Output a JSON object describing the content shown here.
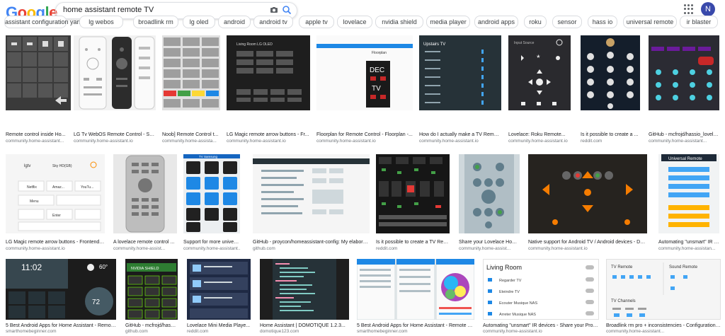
{
  "search": {
    "query": "home assistant remote TV"
  },
  "logo": {
    "letters": [
      "G",
      "o",
      "o",
      "g",
      "l",
      "e"
    ]
  },
  "avatar": {
    "initial": "N"
  },
  "chips": [
    "assistant configuration yaml",
    "lg webos",
    "broadlink rm",
    "lg oled",
    "android",
    "android tv",
    "apple tv",
    "lovelace",
    "nvidia shield",
    "media player",
    "android apps",
    "roku",
    "sensor",
    "hass io",
    "universal remote",
    "ir blaster"
  ],
  "row1": [
    {
      "caption": "Remote control inside Ho...",
      "source": "community.home-assistant..."
    },
    {
      "caption": "LG Tv WebOS Remote Control - Sha...",
      "source": "community.home-assistant.io"
    },
    {
      "caption": "Noob] Remote Control t...",
      "source": "community.home-assista..."
    },
    {
      "caption": "LG Magic remote arrow buttons - Fr...",
      "source": "community.home-assistant.io"
    },
    {
      "caption": "Floorplan for Remote Control - Floorplan -...",
      "source": "community.home-assistant.io"
    },
    {
      "caption": "How do I actually make a TV Remot...",
      "source": "community.home-assistant.io"
    },
    {
      "caption": "Lovelace: Roku Remote...",
      "source": "community.home-assistant.io"
    },
    {
      "caption": "Is it possible to create a ...",
      "source": "reddit.com"
    },
    {
      "caption": "GitHub - mcfrojd/hassio_lovela...",
      "source": "community.home-assistant..."
    }
  ],
  "row2": [
    {
      "caption": "LG Magic remote arrow buttons - Frontend -...",
      "source": "community.home-assistant.io"
    },
    {
      "caption": "A lovelace remote control ...",
      "source": "community.home-assist..."
    },
    {
      "caption": "Support for more universa...",
      "source": "community.home-assistant..."
    },
    {
      "caption": "GitHub - proycon/homeassistant-config: My elabora...",
      "source": "github.com"
    },
    {
      "caption": "Is it possible to create a TV Rem...",
      "source": "reddit.com"
    },
    {
      "caption": "Share your Lovelace Home...",
      "source": "community.home-assist..."
    },
    {
      "caption": "Native support for Android TV / Android devices - Dev...",
      "source": "community.home-assistant.io"
    },
    {
      "caption": "Automating \"unsmart\" IR d...",
      "source": "community.home-assistan..."
    }
  ],
  "row3": [
    {
      "caption": "5 Best Android Apps for Home Assistant - Remot...",
      "source": "smarthomebeginner.com"
    },
    {
      "caption": "GitHub - mcfrojd/hassi...",
      "source": "github.com"
    },
    {
      "caption": "Lovelace Mini Media Playe...",
      "source": "reddit.com"
    },
    {
      "caption": "Home Assistant | DOMOTIQUE 1.2.3...",
      "source": "domotique123.com"
    },
    {
      "caption": "5 Best Android Apps for Home Assistant - Remote co...",
      "source": "smarthomebeginner.com"
    },
    {
      "caption": "Automating \"unsmart\" IR devices - Share your Proje...",
      "source": "community.home-assistant.io"
    },
    {
      "caption": "Broadlink rm pro + inconsistencies - Configuration ...",
      "source": "community.home-assistant..."
    }
  ],
  "thumb_text": {
    "dec": "DEC",
    "tv": "TV",
    "floorplan": "Floorplan",
    "upstairs_tv": "Upstairs TV",
    "input_source": "Input Source",
    "living_room": "Living Room",
    "living_room_lgoled": "Living Room LG OLED",
    "tv_samsung": "TV Samsung",
    "universal_remote": "Universal Remote",
    "time": "11:02",
    "temp": "60°",
    "thermo": "72",
    "lgtv": "lgtv",
    "sky_hd": "Sky HD(GB)",
    "netflix": "Netflix",
    "amazon": "Amaz...",
    "youtube": "YouTu...",
    "menu": "Menu",
    "enter": "Enter",
    "tv_remote": "TV Remote",
    "sound_remote": "Sound Remote",
    "tv_channels": "TV Channels",
    "nvidia_shield": "NVIDIA SHIELD",
    "regarder_tv": "Regarder TV",
    "eteindre_tv": "Eteindre TV",
    "ecouter_musique": "Ecouter Musique NAS",
    "arreter_musique": "Arreter Musique NAS"
  },
  "colors": {
    "google_blue": "#4285f4",
    "google_red": "#ea4335",
    "google_yellow": "#fbbc05",
    "google_green": "#34a853"
  }
}
